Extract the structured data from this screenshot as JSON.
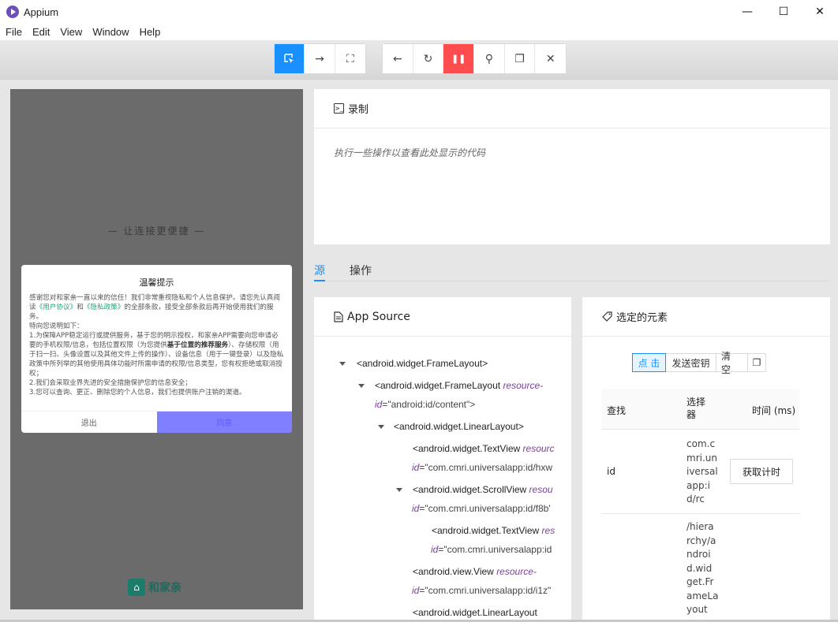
{
  "window": {
    "title": "Appium",
    "minimize_glyph": "—",
    "maximize_glyph": "☐",
    "close_glyph": "✕"
  },
  "menu": [
    "File",
    "Edit",
    "View",
    "Window",
    "Help"
  ],
  "toolbar": {
    "group1": [
      {
        "icon": "select-element-icon",
        "glyph": "⬚"
      },
      {
        "icon": "swipe-icon",
        "glyph": "→"
      },
      {
        "icon": "tap-by-coordinates-icon",
        "glyph": "⛶"
      }
    ],
    "group2": [
      {
        "icon": "back-icon",
        "glyph": "←"
      },
      {
        "icon": "refresh-icon",
        "glyph": "↻"
      },
      {
        "icon": "pause-recording-icon",
        "glyph": "❚❚"
      },
      {
        "icon": "search-icon",
        "glyph": "⚲"
      },
      {
        "icon": "copy-xml-icon",
        "glyph": "❐"
      },
      {
        "icon": "quit-session-icon",
        "glyph": "✕"
      }
    ]
  },
  "device": {
    "slogan": "— 让连接更便捷 —",
    "dialog": {
      "title": "温馨提示",
      "para1_a": "感谢您对和家亲一直以来的信任！我们非常重视隐私和个人信息保护。请您先认真阅读",
      "link_user": "《用户协议》",
      "para1_and": "和",
      "link_privacy": "《隐私政策》",
      "para1_b": "的全部条款，接受全部条款后再开始使用我们的服务。",
      "para2": "特向您说明如下：",
      "para3_a": "1.为保障APP稳定运行或提供服务，基于您的明示授权，和家亲APP需要向您申请必要的手机权限/信息，包括位置权限（为您提供",
      "para3_bold": "基于位置的推荐服务",
      "para3_b": "）、存储权限（用于扫一扫、头像设置以及其他文件上传的操作）、设备信息（用于一键登录）以及隐私政策中所列举的其他使用具体功能时所需申请的权限/信息类型，您有权拒绝或取消授权；",
      "para4": "2.我们会采取业界先进的安全措施保护您的信息安全；",
      "para5": "3.您可以查询、更正、删除您的个人信息，我们也提供账户注销的渠道。",
      "exit": "退出",
      "agree": "同意"
    },
    "logo_text": "和家亲"
  },
  "recorder": {
    "title": "录制",
    "hint": "执行一些操作以查看此处显示的代码"
  },
  "tabs": [
    "源",
    "操作"
  ],
  "source": {
    "title": "App Source",
    "nodes": [
      {
        "text": "<android.widget.FrameLayout>"
      },
      {
        "text": "<android.widget.FrameLayout ",
        "attr": "resource-",
        "line2_attr": "id",
        "line2_val": "=\"android:id/content\">"
      },
      {
        "text": "<android.widget.LinearLayout>"
      },
      {
        "text": "<android.widget.TextView ",
        "attr": "resourc",
        "line2_attr": "id",
        "line2_val": "=\"com.cmri.universalapp:id/hxw"
      },
      {
        "text": "<android.widget.ScrollView ",
        "attr": "resou",
        "line2_attr": "id",
        "line2_val": "=\"com.cmri.universalapp:id/f8b'"
      },
      {
        "text": "<android.widget.TextView ",
        "attr": "res",
        "line2_attr": "id",
        "line2_val": "=\"com.cmri.universalapp:id"
      },
      {
        "text": "<android.view.View ",
        "attr": "resource-",
        "line2_attr": "id",
        "line2_val": "=\"com.cmri.universalapp:id/i1z\""
      },
      {
        "text": "<android.widget.LinearLayout"
      }
    ]
  },
  "selected": {
    "title": "选定的元素",
    "buttons": [
      "点 击",
      "发送密钥",
      "清 空"
    ],
    "copy_icon": "❐",
    "table": {
      "headers": [
        "查找",
        "选择器",
        "时间 (ms)"
      ],
      "header_sel_lines": [
        "选择",
        "器"
      ],
      "rows": [
        {
          "strategy": "id",
          "selector_lines": [
            "com.c",
            "mri.un",
            "iversal",
            "app:i",
            "d/rc"
          ],
          "action": "获取计时"
        },
        {
          "strategy": "",
          "selector_lines": [
            "/hiera",
            "rchy/a",
            "ndroi",
            "d.wid",
            "get.Fr",
            "ameLa",
            "yout"
          ],
          "action": ""
        }
      ]
    }
  }
}
